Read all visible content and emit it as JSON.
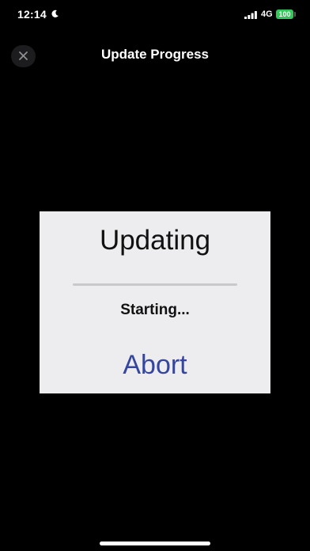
{
  "status_bar": {
    "time": "12:14",
    "network": "4G",
    "battery": "100",
    "icons": [
      "moon-icon",
      "signal-icon"
    ]
  },
  "nav": {
    "title": "Update Progress",
    "close_icon": "close-icon"
  },
  "dialog": {
    "title": "Updating",
    "progress_fraction": 0.0,
    "status": "Starting...",
    "abort_label": "Abort"
  },
  "colors": {
    "background": "#000000",
    "dialog_background": "#ededf0",
    "accent": "#34469e",
    "battery_green": "#34c759"
  }
}
